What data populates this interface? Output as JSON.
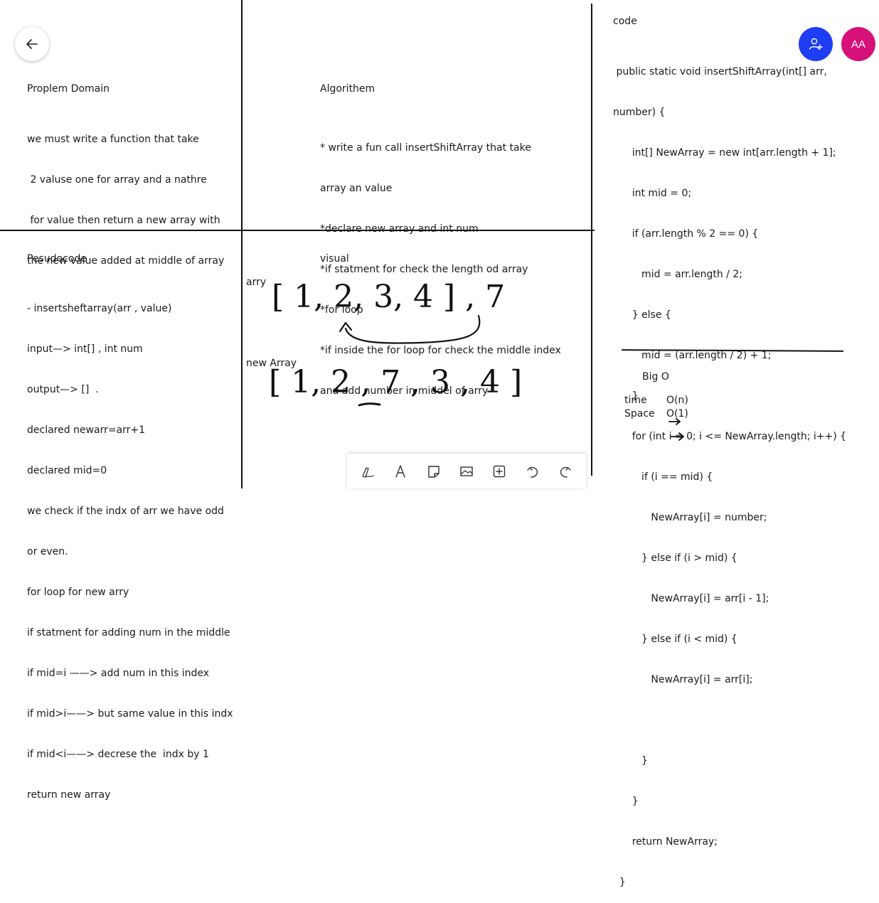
{
  "sections": {
    "problem_domain": {
      "title": "Proplem Domain",
      "lines": [
        "we must write a function that take",
        " 2 valuse one for array and a nathre",
        " for value then return a new array with",
        "the new value added at middle of array"
      ]
    },
    "algorithm": {
      "title": "Algorithem",
      "lines": [
        "* write a fun call insertShiftArray that take",
        "array an value",
        "*declare new array and int num",
        "*if statment for check the length od array",
        "*for loop",
        "*if inside the for loop for check the middle index",
        "and add number in middel of arry"
      ]
    },
    "pseudocode": {
      "title": "Pesudocode",
      "lines": [
        "- insertsheftarray(arr , value)",
        "input—> int[] , int num",
        "output—> []  .",
        "declared newarr=arr+1",
        "declared mid=0",
        "we check if the indx of arr we have odd",
        "or even.",
        "for loop for new arry",
        "if statment for adding num in the middle",
        "if mid=i ——> add num in this index",
        "if mid>i——> but same value in this indx",
        "if mid<i——> decrese the  indx by 1",
        "return new array"
      ]
    },
    "visual": {
      "title": "visual",
      "arry_label": "arry",
      "arry_drawing": "[ 1, 2, 3, 4 ] , 7",
      "new_array_label": "new Array",
      "new_array_drawing": "[ 1, 2 , 7 , 3 , 4 ]"
    },
    "code": {
      "title": "code",
      "lines": [
        " public static void insertShiftArray(int[] arr,",
        "number) {",
        "      int[] NewArray = new int[arr.length + 1];",
        "      int mid = 0;",
        "      if (arr.length % 2 == 0) {",
        "         mid = arr.length / 2;",
        "      } else {",
        "         mid = (arr.length / 2) + 1;",
        "      }",
        "      for (int i = 0; i <= NewArray.length; i++) {",
        "         if (i == mid) {",
        "            NewArray[i] = number;",
        "         } else if (i > mid) {",
        "            NewArray[i] = arr[i - 1];",
        "         } else if (i < mid) {",
        "            NewArray[i] = arr[i];",
        "",
        "         }",
        "      }",
        "      return NewArray;",
        "  }"
      ]
    },
    "big_o": {
      "title": "Big O",
      "time_label": "time",
      "time_value": "O(n)",
      "space_label": "Space",
      "space_value": "O(1)"
    }
  },
  "avatar": {
    "initials": "AA",
    "color": "#d6127a"
  },
  "share_button": {
    "color": "#1e3df5"
  },
  "toolbar": {
    "tools": [
      "pen-icon",
      "text-icon",
      "note-icon",
      "image-icon",
      "add-icon",
      "undo-icon",
      "redo-icon"
    ]
  }
}
